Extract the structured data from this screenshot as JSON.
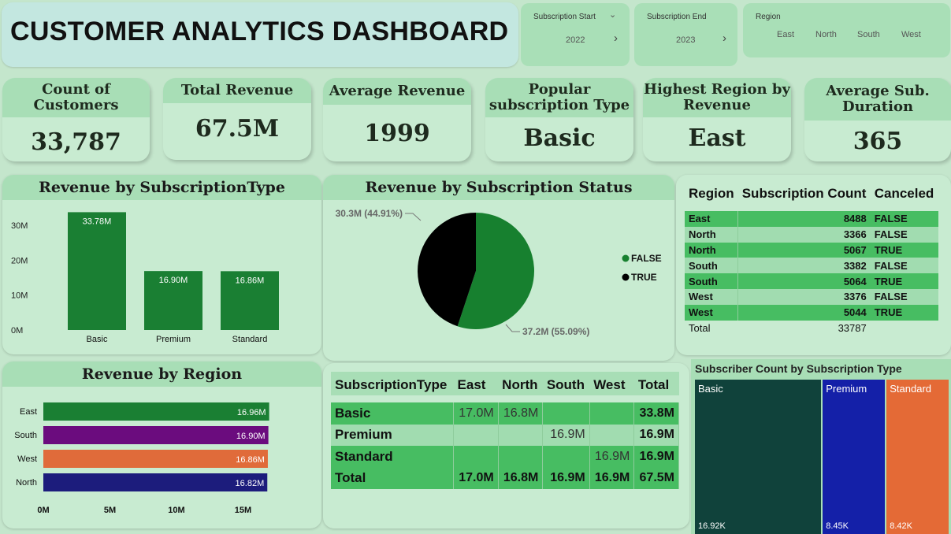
{
  "title": "CUSTOMER ANALYTICS DASHBOARD",
  "slicers": {
    "sub_start": {
      "label": "Subscription Start",
      "value": "2022"
    },
    "sub_end": {
      "label": "Subscription End",
      "value": "2023"
    },
    "region": {
      "label": "Region",
      "options": [
        "East",
        "North",
        "South",
        "West"
      ]
    }
  },
  "kpis": [
    {
      "label": "Count of Customers",
      "value": "33,787"
    },
    {
      "label": "Total Revenue",
      "value": "67.5M"
    },
    {
      "label": "Average Revenue",
      "value": "1999"
    },
    {
      "label": "Popular subscription Type",
      "value": "Basic"
    },
    {
      "label": "Highest Region by Revenue",
      "value": "East"
    },
    {
      "label": "Average Sub. Duration",
      "value": "365"
    }
  ],
  "bar_chart": {
    "title": "Revenue by SubscriptionType",
    "y_ticks": [
      "30M",
      "20M",
      "10M",
      "0M"
    ],
    "chart_data": {
      "type": "bar",
      "categories": [
        "Basic",
        "Premium",
        "Standard"
      ],
      "values": [
        33.78,
        16.9,
        16.86
      ],
      "data_labels": [
        "33.78M",
        "16.90M",
        "16.86M"
      ],
      "ylim": [
        0,
        35
      ],
      "unit": "M",
      "color": "#1a7f33"
    }
  },
  "pie_chart": {
    "title": "Revenue by Subscription Status",
    "chart_data": {
      "type": "pie",
      "labels": [
        "FALSE",
        "TRUE"
      ],
      "values": [
        37.2,
        30.3
      ],
      "percent": [
        55.09,
        44.91
      ],
      "data_labels": [
        "37.2M (55.09%)",
        "30.3M (44.91%)"
      ],
      "colors": [
        "#17802f",
        "#000000"
      ]
    },
    "legend": [
      "FALSE",
      "TRUE"
    ]
  },
  "region_table": {
    "headers": [
      "Region",
      "Subscription Count",
      "Canceled"
    ],
    "rows": [
      [
        "East",
        "8488",
        "FALSE"
      ],
      [
        "North",
        "3366",
        "FALSE"
      ],
      [
        "North",
        "5067",
        "TRUE"
      ],
      [
        "South",
        "3382",
        "FALSE"
      ],
      [
        "South",
        "5064",
        "TRUE"
      ],
      [
        "West",
        "3376",
        "FALSE"
      ],
      [
        "West",
        "5044",
        "TRUE"
      ]
    ],
    "total": [
      "Total",
      "33787",
      ""
    ]
  },
  "hbar_chart": {
    "title": "Revenue by Region",
    "x_ticks": [
      "0M",
      "5M",
      "10M",
      "15M"
    ],
    "chart_data": {
      "type": "bar",
      "orientation": "horizontal",
      "categories": [
        "East",
        "South",
        "West",
        "North"
      ],
      "values": [
        16.96,
        16.9,
        16.86,
        16.82
      ],
      "data_labels": [
        "16.96M",
        "16.90M",
        "16.86M",
        "16.82M"
      ],
      "colors": [
        "#1a7f33",
        "#6b0c7e",
        "#e06b3a",
        "#1c1c7c"
      ],
      "xlim": [
        0,
        17
      ],
      "unit": "M"
    }
  },
  "matrix": {
    "headers": [
      "SubscriptionType",
      "East",
      "North",
      "South",
      "West",
      "Total"
    ],
    "rows": [
      [
        "Basic",
        "17.0M",
        "16.8M",
        "",
        "",
        "33.8M"
      ],
      [
        "Premium",
        "",
        "",
        "16.9M",
        "",
        "16.9M"
      ],
      [
        "Standard",
        "",
        "",
        "",
        "16.9M",
        "16.9M"
      ],
      [
        "Total",
        "17.0M",
        "16.8M",
        "16.9M",
        "16.9M",
        "67.5M"
      ]
    ]
  },
  "treemap": {
    "title": "Subscriber Count by Subscription Type",
    "chart_data": {
      "type": "treemap",
      "categories": [
        "Basic",
        "Premium",
        "Standard"
      ],
      "values": [
        16.92,
        8.45,
        8.42
      ],
      "data_labels": [
        "16.92K",
        "8.45K",
        "8.42K"
      ],
      "unit": "K",
      "colors": [
        "#10423b",
        "#1420a8",
        "#e46a36"
      ]
    }
  }
}
